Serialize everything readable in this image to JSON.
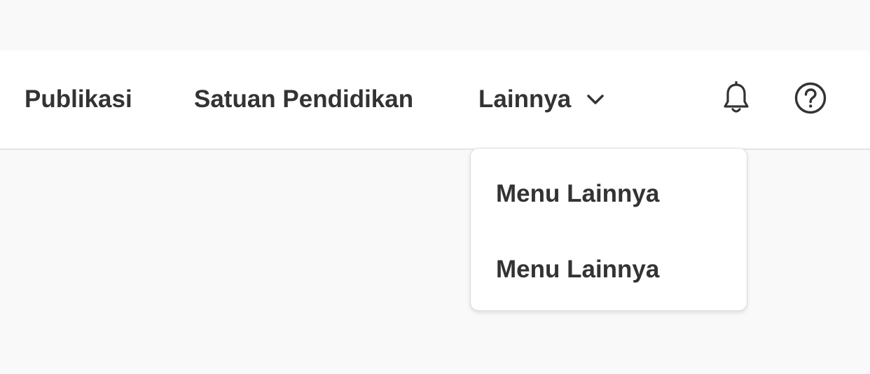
{
  "navbar": {
    "items": [
      {
        "label": "Publikasi"
      },
      {
        "label": "Satuan Pendidikan"
      },
      {
        "label": "Lainnya",
        "icon": "chevron-down-icon"
      }
    ],
    "icons": {
      "notifications": "bell-icon",
      "help": "help-circle-icon"
    }
  },
  "dropdown": {
    "items": [
      {
        "label": "Menu Lainnya"
      },
      {
        "label": "Menu Lainnya"
      }
    ]
  },
  "colors": {
    "page_background": "#f9f9f9",
    "navbar_background": "#ffffff",
    "text": "#333333",
    "border": "#e4e4e4"
  }
}
